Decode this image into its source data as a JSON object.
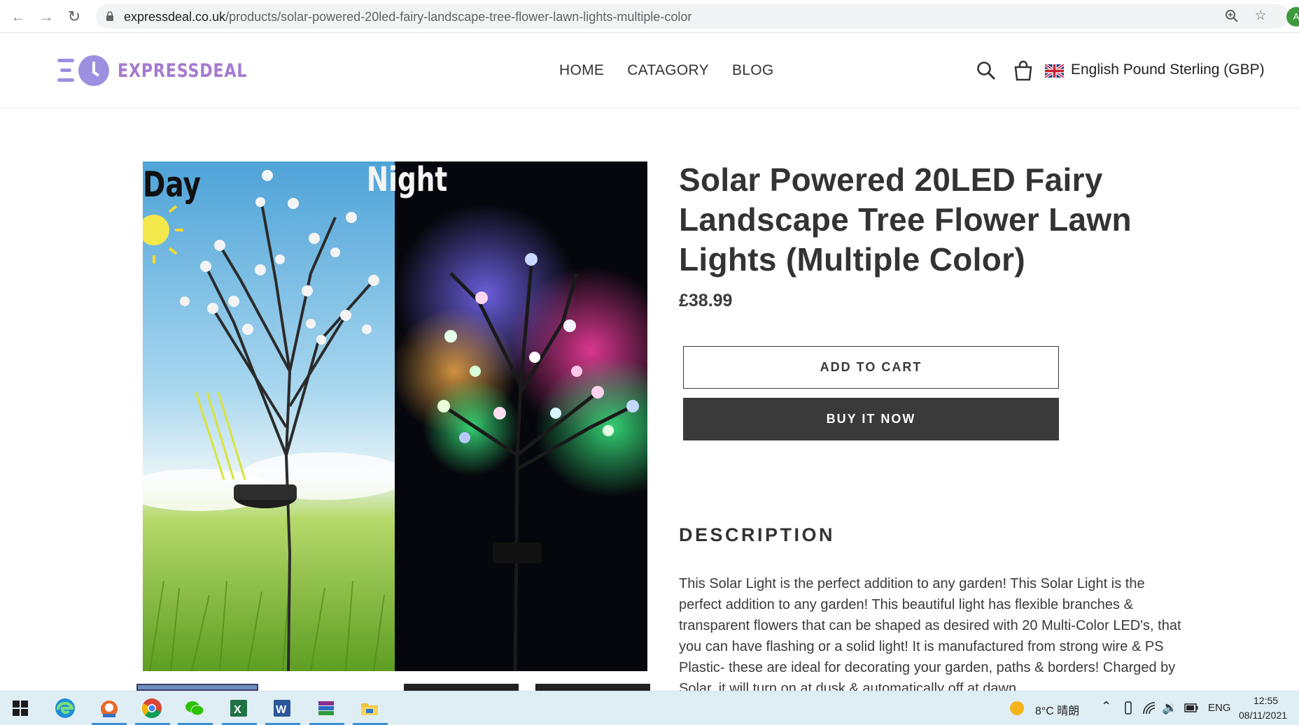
{
  "browser": {
    "url_host": "expressdeal.co.uk",
    "url_path": "/products/solar-powered-20led-fairy-landscape-tree-flower-lawn-lights-multiple-color",
    "profile_initial": "A"
  },
  "header": {
    "logo_text": "EXPRESSDEAL",
    "nav": [
      "HOME",
      "CATAGORY",
      "BLOG"
    ],
    "currency": "English Pound Sterling (GBP)"
  },
  "product": {
    "image_label_day": "Day",
    "image_label_night": "Night",
    "title": "Solar Powered 20LED Fairy Landscape Tree Flower Lawn Lights (Multiple Color)",
    "price": "£38.99",
    "add_to_cart": "ADD TO CART",
    "buy_now": "BUY IT NOW",
    "description_heading": "DESCRIPTION",
    "description": "This Solar Light is the perfect addition to any garden! This Solar Light is the perfect addition to any garden! This beautiful light has flexible branches & transparent flowers that can be shaped as desired with 20 Multi-Color LED's, that you can have flashing or a solid light! It is manufactured from strong wire & PS Plastic- these are ideal for decorating your garden, paths & borders! Charged by Solar, it will turn on at dusk & automatically off at dawn."
  },
  "taskbar": {
    "weather": "8°C 晴朗",
    "language": "ENG",
    "time": "12:55",
    "date": "08/11/2021"
  },
  "colors": {
    "accent_logo": "#9d8fe0",
    "button_dark": "#3a3a3a",
    "taskbar": "#dfeef4"
  }
}
